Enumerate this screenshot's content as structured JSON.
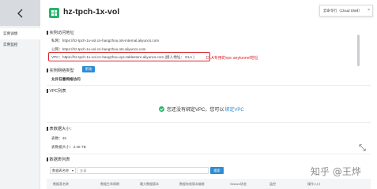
{
  "header": {
    "title": "hz-tpch-1x-vol"
  },
  "sidebar": {
    "items": [
      {
        "label": "实例详情"
      },
      {
        "label": "实例监控"
      }
    ]
  },
  "popup": {
    "text": "云命令行（Cloud Shell）"
  },
  "access": {
    "section_title": "实例访问地址",
    "private_label": "私网：",
    "private_value": "https://hz-tpch-1x-vol.cn-hangzhou.ots-internal.aliyuncs.com",
    "public_label": "公网：",
    "public_value": "https://hz-tpch-1x-vol.cn-hangzhou.ots.aliyuncs.com",
    "vpc_label": "VPC：",
    "vpc_value": "https://hz-tpch-1x-vol.cn-hangzhou.vpc.tablestore.aliyuncs.com",
    "vpc_note": "(接入地址： DLA )",
    "annotation": "DLA专用的vpc anytunnel地址"
  },
  "network": {
    "section_title": "实例网络类型",
    "change_button": "更改",
    "allow_label": "允许任意网络访问"
  },
  "vpc_list": {
    "section_title": "VPC列表",
    "empty_text": "您还没有绑定VPC，您可以",
    "bind_link": "绑定VPC"
  },
  "table_size": {
    "section_title": "表数据大小：",
    "count_label": "表数：",
    "count_value": "45",
    "size_label": "表数据大小：",
    "size_value": "2.45 TB"
  },
  "data_tables": {
    "section_title": "数据表列表",
    "filter_select": "数据表名称",
    "search_placeholder": "支录",
    "search_button": "搜索",
    "columns": [
      "数据表名称",
      "数据生命周期",
      "最大数据版本",
      "数据有效版本偏差",
      "Stream状态",
      "监控",
      "操作入口"
    ]
  },
  "watermark": "知乎 @王烨"
}
